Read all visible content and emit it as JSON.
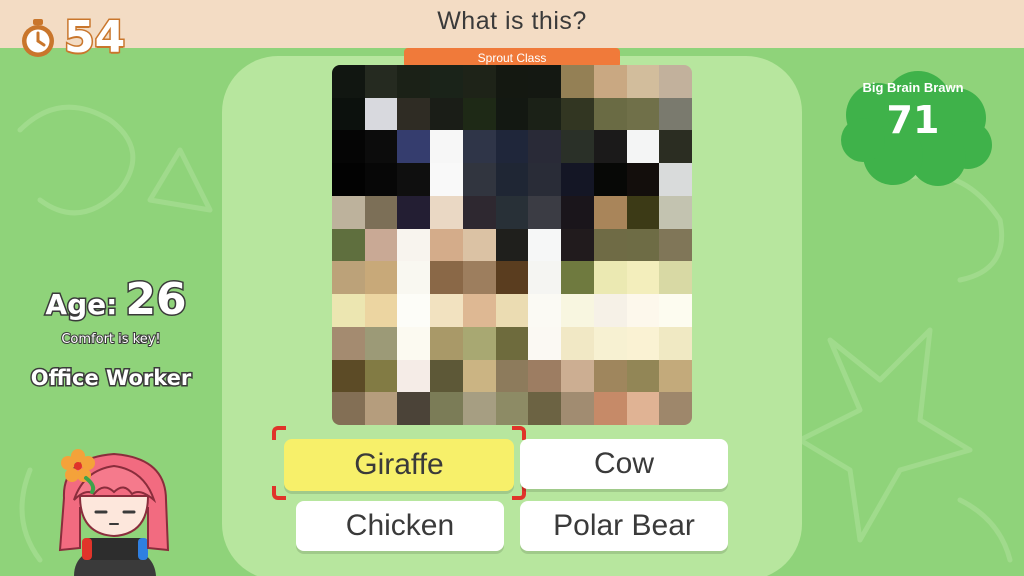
{
  "header": {
    "question": "What is this?",
    "class_badge": "Sprout Class"
  },
  "timer": {
    "icon": "stopwatch-icon",
    "value": "54"
  },
  "score": {
    "label": "Big Brain Brawn",
    "value": "71"
  },
  "player": {
    "age_label": "Age:",
    "age": "26",
    "motto": "Comfort is key!",
    "occupation": "Office Worker",
    "avatar_icon": "player-avatar-icon"
  },
  "answers": [
    {
      "label": "Giraffe",
      "selected": true
    },
    {
      "label": "Cow",
      "selected": false
    },
    {
      "label": "Chicken",
      "selected": false
    },
    {
      "label": "Polar Bear",
      "selected": false
    }
  ],
  "mosaic": {
    "rows": [
      [
        "#111611",
        "#252a20",
        "#1b2117",
        "#1a2319",
        "#1e2318",
        "#141811",
        "#141812",
        "#948055",
        "#c9a882",
        "#d2bd9c",
        "#c2b19c"
      ],
      [
        "#0c110d",
        "#d8d9de",
        "#2f2c24",
        "#1a1d17",
        "#1e2916",
        "#131812",
        "#1b2117",
        "#323622",
        "#6a6b44",
        "#707049",
        "#7a7a6e"
      ],
      [
        "#050505",
        "#0c0c0c",
        "#353d6e",
        "#f7f7f7",
        "#2f3548",
        "#1f263a",
        "#292a37",
        "#2a3028",
        "#1b1a1a",
        "#f4f5f5",
        "#2b2d22"
      ],
      [
        "#020202",
        "#070707",
        "#0f0f0f",
        "#f9f9f9",
        "#31353f",
        "#1f2634",
        "#292c37",
        "#141625",
        "#070806",
        "#130e0c",
        "#d9dbdb"
      ],
      [
        "#bdb29c",
        "#7c6f57",
        "#231e33",
        "#ead8c4",
        "#2e2830",
        "#283037",
        "#3b3c44",
        "#1a151b",
        "#a9855a",
        "#3c3a16",
        "#c3c3b0"
      ],
      [
        "#5f6f3e",
        "#c9a995",
        "#f8f4ee",
        "#d4ac8a",
        "#dbc2a4",
        "#1f1f1c",
        "#f6f7f7",
        "#211b1d",
        "#6f6b45",
        "#6e6c45",
        "#807658"
      ],
      [
        "#bca279",
        "#c8a979",
        "#f9f8f1",
        "#8a6847",
        "#9d7e5e",
        "#5a3d1f",
        "#f5f5f2",
        "#6f7a3f",
        "#ebe9b2",
        "#f3eebc",
        "#d8d9a4"
      ],
      [
        "#ece6b1",
        "#ecd5a1",
        "#fdfdf8",
        "#f2e2c0",
        "#deb893",
        "#ebdcb2",
        "#fbfaf4",
        "#f8f6e0",
        "#f6f1e7",
        "#fdf8ec",
        "#fdfcf0"
      ],
      [
        "#a48b70",
        "#9c9a77",
        "#fcfaf1",
        "#a99968",
        "#a8a872",
        "#6e6b3d",
        "#fbf9f3",
        "#f1e8c5",
        "#f7f1d2",
        "#faf2d3",
        "#f0e9c3"
      ],
      [
        "#5c4b26",
        "#827b44",
        "#f5ece7",
        "#5d5837",
        "#cbb483",
        "#8d7b5c",
        "#9d7d62",
        "#ccae92",
        "#9f865d",
        "#928656",
        "#c3aa7b"
      ],
      [
        "#836f55",
        "#b59d7d",
        "#4b4338",
        "#7b7c57",
        "#a69e82",
        "#8d8b65",
        "#6c6343",
        "#a18c71",
        "#c68a68",
        "#e0b394",
        "#9e876b"
      ]
    ]
  }
}
